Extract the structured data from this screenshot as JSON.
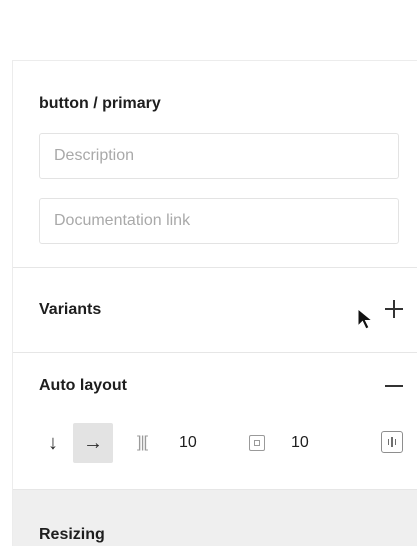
{
  "component": {
    "name": "button / primary",
    "description_placeholder": "Description",
    "description_value": "",
    "doc_link_placeholder": "Documentation link",
    "doc_link_value": ""
  },
  "variants": {
    "title": "Variants",
    "add_icon": "plus-icon"
  },
  "auto_layout": {
    "title": "Auto layout",
    "remove_icon": "minus-icon",
    "direction_down_icon": "↓",
    "direction_right_icon": "→",
    "selected_direction": "horizontal",
    "spacing_icon": "]|[",
    "spacing_value": "10",
    "padding_icon": "padding-icon",
    "padding_value": "10",
    "alignment_icon": "alignment-icon"
  },
  "resizing": {
    "title": "Resizing"
  },
  "colors": {
    "selected_bg": "#e3e3e3",
    "resizing_bg": "#efefef",
    "placeholder": "#a9a9a9"
  }
}
